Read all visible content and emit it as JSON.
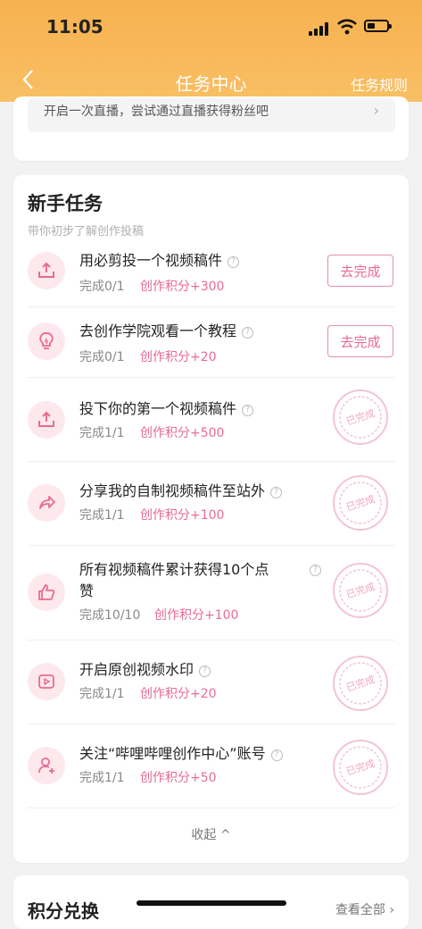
{
  "status_bar": {
    "time": "11:05"
  },
  "nav": {
    "back_icon": "chevron-left-icon",
    "title": "任务中心",
    "rules_label": "任务规则"
  },
  "prev_task": {
    "text": "开启一次直播，尝试通过直播获得粉丝吧",
    "chevron": "›"
  },
  "newbie": {
    "title": "新手任务",
    "subtitle": "带你初步了解创作投稿",
    "tasks": [
      {
        "icon": "upload-icon",
        "name": "用必剪投一个视频稿件",
        "progress": "完成0/1",
        "points": "创作积分+300",
        "action": "去完成"
      },
      {
        "icon": "lightbulb-icon",
        "name": "去创作学院观看一个教程",
        "progress": "完成0/1",
        "points": "创作积分+20",
        "action": "去完成"
      },
      {
        "icon": "upload-icon",
        "name": "投下你的第一个视频稿件",
        "progress": "完成1/1",
        "points": "创作积分+500",
        "stamp": "已完成"
      },
      {
        "icon": "share-icon",
        "name": "分享我的自制视频稿件至站外",
        "progress": "完成1/1",
        "points": "创作积分+100",
        "stamp": "已完成"
      },
      {
        "icon": "thumbs-up-icon",
        "name_line1": "所有视频稿件累计获得10个点",
        "name_line2": "赞",
        "progress": "完成10/10",
        "points": "创作积分+100",
        "stamp": "已完成"
      },
      {
        "icon": "video-play-icon",
        "name": "开启原创视频水印",
        "progress": "完成1/1",
        "points": "创作积分+20",
        "stamp": "已完成"
      },
      {
        "icon": "user-add-icon",
        "name": "关注“哔哩哔哩创作中心”账号",
        "progress": "完成1/1",
        "points": "创作积分+50",
        "stamp": "已完成"
      }
    ],
    "help_mark": "?",
    "collapse_label": "收起 ^"
  },
  "points_exchange": {
    "title": "积分兑换",
    "view_all": "查看全部 ›"
  },
  "colors": {
    "header": "#f7b14f",
    "accent": "#e76b93",
    "icon_bg": "#fde8ee"
  }
}
